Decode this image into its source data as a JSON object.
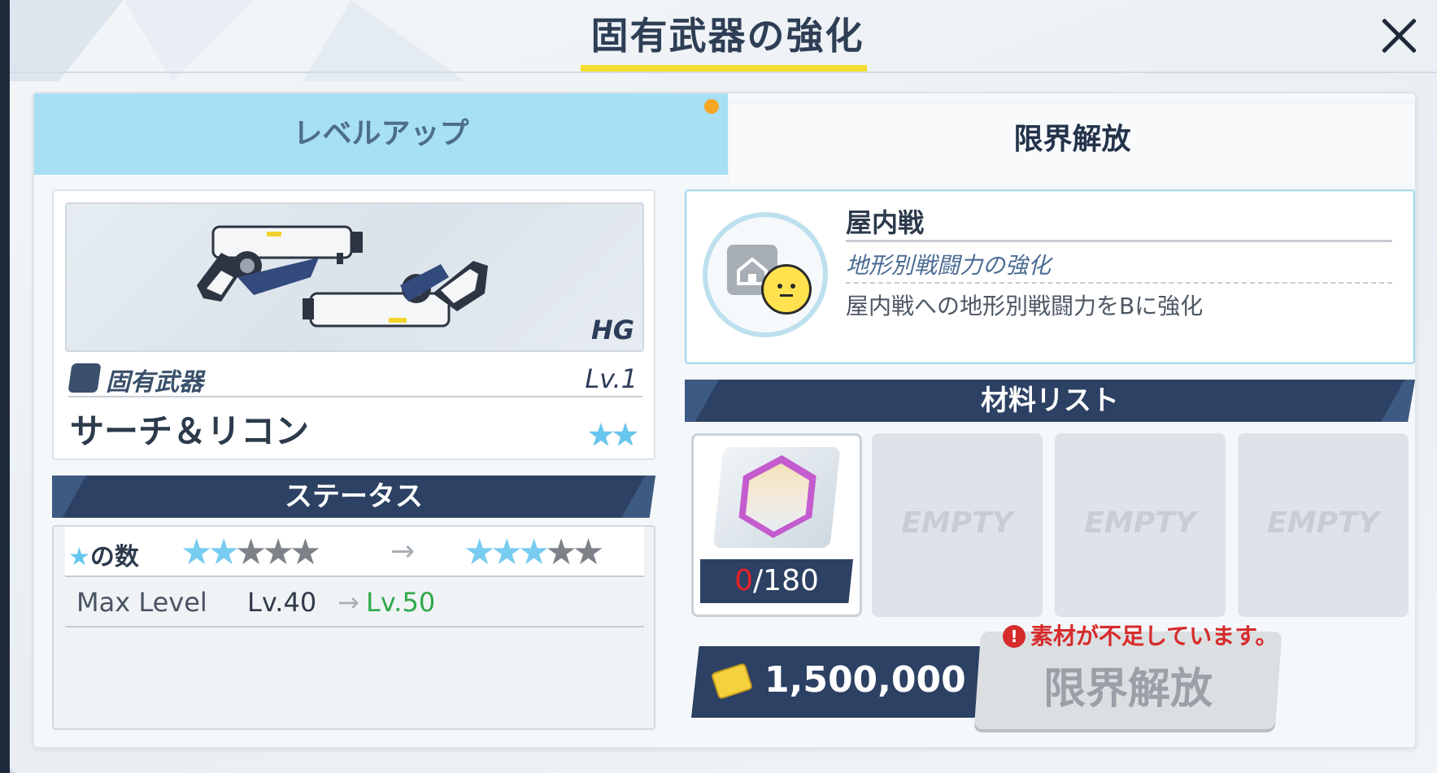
{
  "header": {
    "title": "固有武器の強化"
  },
  "tabs": [
    {
      "label": "レベルアップ",
      "active": false
    },
    {
      "label": "限界解放",
      "active": true
    }
  ],
  "weapon": {
    "class": "HG",
    "type_label": "固有武器",
    "level": "Lv.1",
    "name": "サーチ＆リコン",
    "stars": "★★"
  },
  "status": {
    "header": "ステータス",
    "stars_label": "の数",
    "stars_before_filled": 2,
    "stars_after_filled": 3,
    "stars_total": 5,
    "max_level_label": "Max Level",
    "max_level_from": "Lv.40",
    "max_level_to": "Lv.50"
  },
  "skill": {
    "name": "屋内戦",
    "subtitle": "地形別戦闘力の強化",
    "description": "屋内戦への地形別戦闘力をBに強化"
  },
  "materials": {
    "header": "材料リスト",
    "item_owned": "0",
    "item_required": "/180",
    "empty_label": "EMPTY"
  },
  "cost": {
    "amount": "1,500,000"
  },
  "warning": {
    "icon": "!",
    "text": "素材が不足しています。"
  },
  "action": {
    "label": "限界解放"
  },
  "colors": {
    "accent_tab": "#a7dff4",
    "band": "#2c4163",
    "title_underline": "#f4dc2e",
    "warning": "#d62b2b",
    "level_up": "#2fa84a"
  }
}
